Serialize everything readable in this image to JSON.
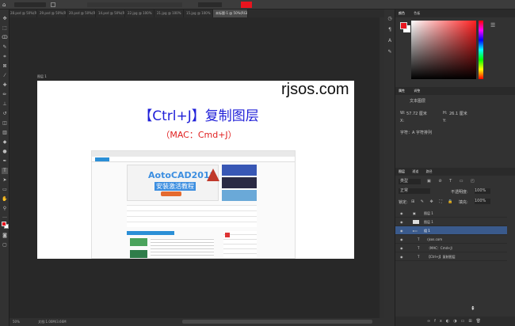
{
  "app": {
    "accent": "#31a8ff"
  },
  "tabs": [
    "28.psd @ 50%(RGB/8)",
    "29.psd @ 50%(RGB/8)",
    "20.psd @ 50%(RGB/8)",
    "14.psd @ 50%(RGB/8)",
    "22.jpg @ 100%",
    "21.jpg @ 100%",
    "15.jpg @ 100%",
    "未标题-1 @ 50%(RGB/8)"
  ],
  "active_tab_index": 7,
  "document": {
    "label": "图层 1",
    "watermark": "rjsos.com",
    "shortcut_title": "【Ctrl+J】复制图层",
    "mac_shortcut": "（MAC：Cmd+J）",
    "banner_text": "AotoCAD2018",
    "banner_sub": "安装激活教程"
  },
  "status": {
    "zoom": "50%",
    "doc_info": "文档:1.00M/3.66M"
  },
  "color_panel": {
    "tabs": [
      "颜色",
      "色板"
    ]
  },
  "properties_panel": {
    "tabs": [
      "属性",
      "调整"
    ],
    "kind": "文本图层",
    "w_label": "W:",
    "w_value": "57.72 厘米",
    "h_label": "H:",
    "h_value": "26.1 厘米",
    "x_label": "X:",
    "x_value": "",
    "y_label": "Y:",
    "y_value": "",
    "snippet": "字符：A 字符排列"
  },
  "layers_panel": {
    "tabs": [
      "图层",
      "通道",
      "路径"
    ],
    "kind_filter": "类型",
    "mode": "正常",
    "opacity_label": "不透明度:",
    "opacity": "100%",
    "lock_label": "锁定:",
    "fill_label": "填充:",
    "fill": "100%",
    "layers": [
      {
        "name": "图层 1",
        "type": "image",
        "selected": false
      },
      {
        "name": "图层 1",
        "type": "image",
        "selected": false
      },
      {
        "name": "组 1",
        "type": "group",
        "selected": true
      },
      {
        "name": "rjsos.com",
        "type": "text",
        "selected": false
      },
      {
        "name": "（MAC：Cmd+J）",
        "type": "text",
        "selected": false
      },
      {
        "name": "【Ctrl+J】复制图层",
        "type": "text",
        "selected": false
      }
    ]
  },
  "colors": {
    "foreground": "#e8141e",
    "background": "#ffffff",
    "highlight": "#3a5a8c"
  }
}
